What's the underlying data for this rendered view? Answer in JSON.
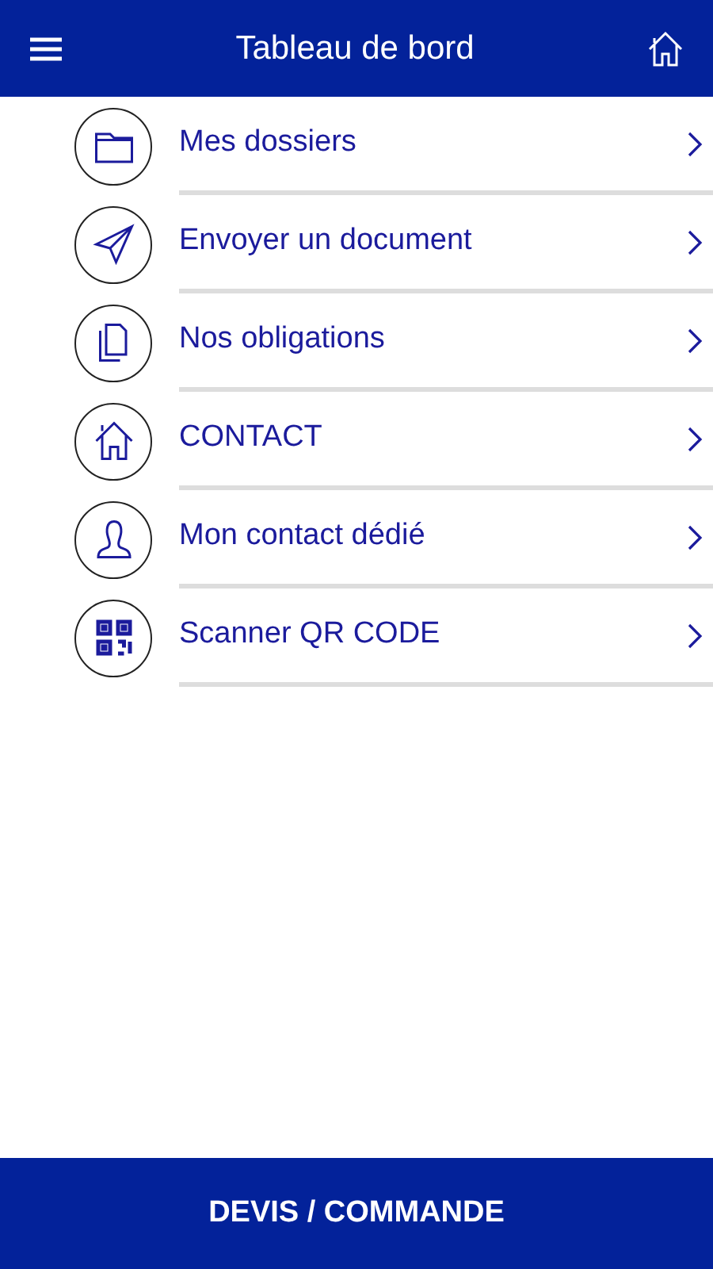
{
  "header": {
    "title": "Tableau de bord"
  },
  "menu": [
    {
      "label": "Mes dossiers",
      "kind": "folder"
    },
    {
      "label": "Envoyer un document",
      "kind": "send"
    },
    {
      "label": "Nos obligations",
      "kind": "pages"
    },
    {
      "label": "CONTACT",
      "kind": "house"
    },
    {
      "label": "Mon contact dédié",
      "kind": "person"
    },
    {
      "label": "Scanner QR CODE",
      "kind": "qr"
    }
  ],
  "footer": {
    "label": "DEVIS / COMMANDE"
  }
}
